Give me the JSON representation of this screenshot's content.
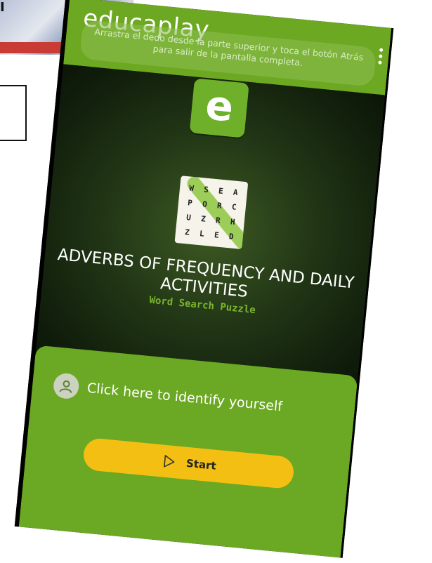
{
  "background": {
    "corner_letter": "I"
  },
  "app": {
    "brand": "educaplay",
    "toast": "Arrastra el dedo desde la parte superior y toca el botón Atrás para salir de la pantalla completa.",
    "menu_icon": "vertical-dots-icon",
    "app_icon_letter": "e"
  },
  "puzzle_icon": {
    "grid": [
      "W",
      "S",
      "E",
      "A",
      "P",
      "O",
      "R",
      "C",
      "U",
      "Z",
      "R",
      "H",
      "Z",
      "L",
      "E",
      "D"
    ]
  },
  "game": {
    "title": "ADVERBS OF FREQUENCY AND DAILY ACTIVITIES",
    "subtitle": "Word Search Puzzle"
  },
  "actions": {
    "identify_label": "Click here to identify yourself",
    "start_label": "Start"
  },
  "colors": {
    "brand_green": "#6da822",
    "start_yellow": "#f3bf12",
    "subtitle_green": "#79b52d"
  }
}
